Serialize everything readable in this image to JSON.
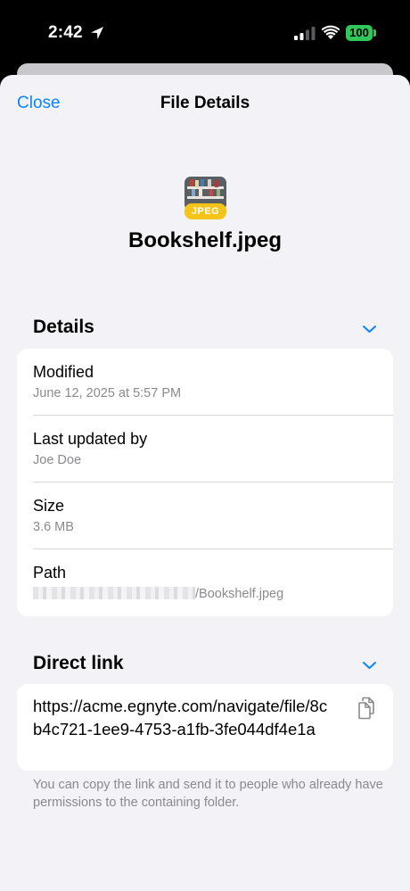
{
  "status_bar": {
    "time": "2:42",
    "battery": "100",
    "icons": [
      "location-arrow-icon",
      "cellular-signal-icon",
      "wifi-icon",
      "battery-icon"
    ]
  },
  "header": {
    "close_label": "Close",
    "title": "File Details"
  },
  "file": {
    "badge": "JPEG",
    "name": "Bookshelf.jpeg"
  },
  "details": {
    "title": "Details",
    "rows": [
      {
        "label": "Modified",
        "value": "June 12, 2025 at 5:57 PM"
      },
      {
        "label": "Last updated by",
        "value": "Joe Doe"
      },
      {
        "label": "Size",
        "value": "3.6 MB"
      },
      {
        "label": "Path",
        "value": "/Bookshelf.jpeg"
      }
    ]
  },
  "direct_link": {
    "title": "Direct link",
    "url": "https://acme.egnyte.com/navigate/file/8cb4c721-1ee9-4753-a1fb-3fe044df4e1a",
    "note": "You can copy the link and send it to people who already have permissions to the containing folder."
  },
  "colors": {
    "accent": "#0a84ff",
    "background": "#f2f2f7",
    "jpeg_badge": "#f4c518",
    "battery": "#30c759"
  }
}
